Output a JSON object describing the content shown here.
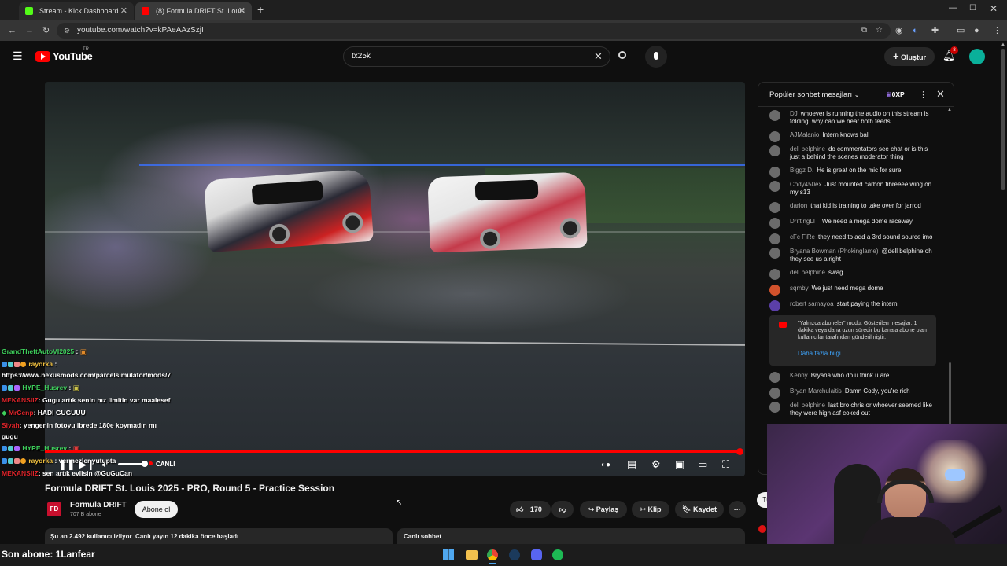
{
  "tabs": [
    {
      "title": "Stream - Kick Dashboard",
      "favicon_color": "#53fc18"
    },
    {
      "title": "(8) Formula DRIFT St. Louis",
      "favicon_color": "#ff0000"
    }
  ],
  "address": {
    "url": "youtube.com/watch?v=kPAeAAzSzjI"
  },
  "youtube": {
    "logo": "YouTube",
    "region": "TR",
    "search_value": "tx25k",
    "create_label": "Oluştur",
    "notif_count": "8"
  },
  "video": {
    "live_label": "CANLI",
    "title": "Formula DRIFT St. Louis 2025 - PRO, Round 5 - Practice Session",
    "channel": "Formula DRIFT",
    "channel_initials": "FD",
    "subscribers": "707 B abone",
    "subscribe_label": "Abone ol",
    "likes": "170",
    "share_label": "Paylaş",
    "clip_label": "Klip",
    "save_label": "Kaydet",
    "viewers_info": "Şu an 2.492 kullanıcı izliyor  Canlı yayın 12 dakika önce başladı",
    "live_chat_tab": "Canlı sohbet"
  },
  "overlay_chat": [
    {
      "user": "GrandTheftAutoVI2025",
      "text": ":",
      "color": "#3ecf5b"
    },
    {
      "user": "rayorka",
      "text": ":",
      "color": "#f0c040"
    },
    {
      "user": "",
      "text": "https://www.nexusmods.com/parcelsimulator/mods/7",
      "color": "#ffffff"
    },
    {
      "user": "HYPE_Husrev",
      "text": ":",
      "color": "#3ecf5b"
    },
    {
      "user": "MEKANSIIZ",
      "text": ": Gugu artık senin hız limitin var maalesef",
      "color": "#e0242a"
    },
    {
      "user": "MrCenp",
      "text": ": HADİ GUGUUU",
      "color": "#e0242a"
    },
    {
      "user": "Siyah",
      "text": ": yengenin fotoyu ibrede 180e koymadın mı",
      "color": "#e0242a"
    },
    {
      "user": "",
      "text": "gugu",
      "color": "#ffffff"
    },
    {
      "user": "HYPE_Husrev",
      "text": ":",
      "color": "#3ecf5b"
    },
    {
      "user": "rayorka",
      "text": ": vermezler yutupta",
      "color": "#f0c040"
    },
    {
      "user": "MEKANSIIZ",
      "text": ": sen artık evlisin @GuGuCan",
      "color": "#e0242a"
    }
  ],
  "chatpanel": {
    "header": "Popüler sohbet mesajları",
    "xp": "0XP",
    "messages": [
      {
        "author": "DJ",
        "text": "whoever is running the audio on this stream is folding. why can we hear both feeds"
      },
      {
        "author": "AJMalanio",
        "text": "Intern knows ball"
      },
      {
        "author": "dell belphine",
        "text": "do commentators see chat or is this just a behind the scenes moderator thing"
      },
      {
        "author": "Biggz D.",
        "text": "He is great on the mic for sure"
      },
      {
        "author": "Cody450ex",
        "text": "Just mounted carbon fibreeee wing on my s13"
      },
      {
        "author": "darion",
        "text": "that kid is training to take over for jarrod"
      },
      {
        "author": "DriftingLIT",
        "text": "We need a mega dome raceway"
      },
      {
        "author": "cFc FiRe",
        "text": "they need to add a 3rd sound source imo"
      },
      {
        "author": "Bryana Bowman (Phokinglame)",
        "text": "@dell belphine oh they see us alright"
      },
      {
        "author": "dell belphine",
        "text": "swag"
      },
      {
        "author": "sqmby",
        "text": "We just need mega dome"
      },
      {
        "author": "robert samayoa",
        "text": "start paying the intern"
      }
    ],
    "notice_text": "\"Yalnızca aboneler\" modu. Gösterilen mesajlar, 1 dakika veya daha uzun süredir bu kanala abone olan kullanıcılar tarafından gönderilmiştir.",
    "notice_link": "Daha fazla bilgi",
    "messages2": [
      {
        "author": "Kenny",
        "text": "Bryana who do u think u are"
      },
      {
        "author": "Bryan Marchulaitis",
        "text": "Damn Cody, you're rich"
      },
      {
        "author": "dell belphine",
        "text": "last bro chris or whoever seemed like they were high asf coked out"
      }
    ]
  },
  "stream_footer": {
    "last_sub": "Son abone: 1Lanfear"
  },
  "side_button": "Tü"
}
